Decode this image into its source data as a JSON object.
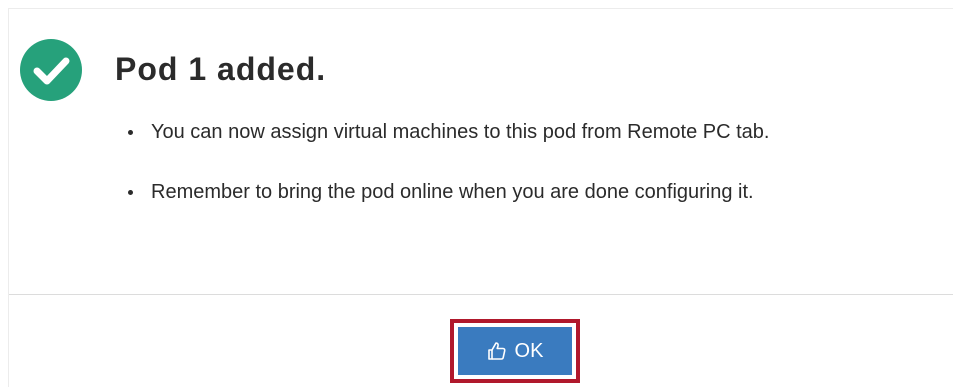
{
  "dialog": {
    "title": "Pod 1 added.",
    "icon": "check-circle-icon",
    "icon_color": "#26a17b",
    "messages": [
      "You can now assign virtual machines to this pod from Remote PC tab.",
      "Remember to bring the pod online when you are done configuring it."
    ]
  },
  "footer": {
    "ok_label": "OK",
    "ok_icon": "thumbs-up-icon",
    "ok_color": "#3a7bbf",
    "highlight_color": "#b0182c"
  }
}
